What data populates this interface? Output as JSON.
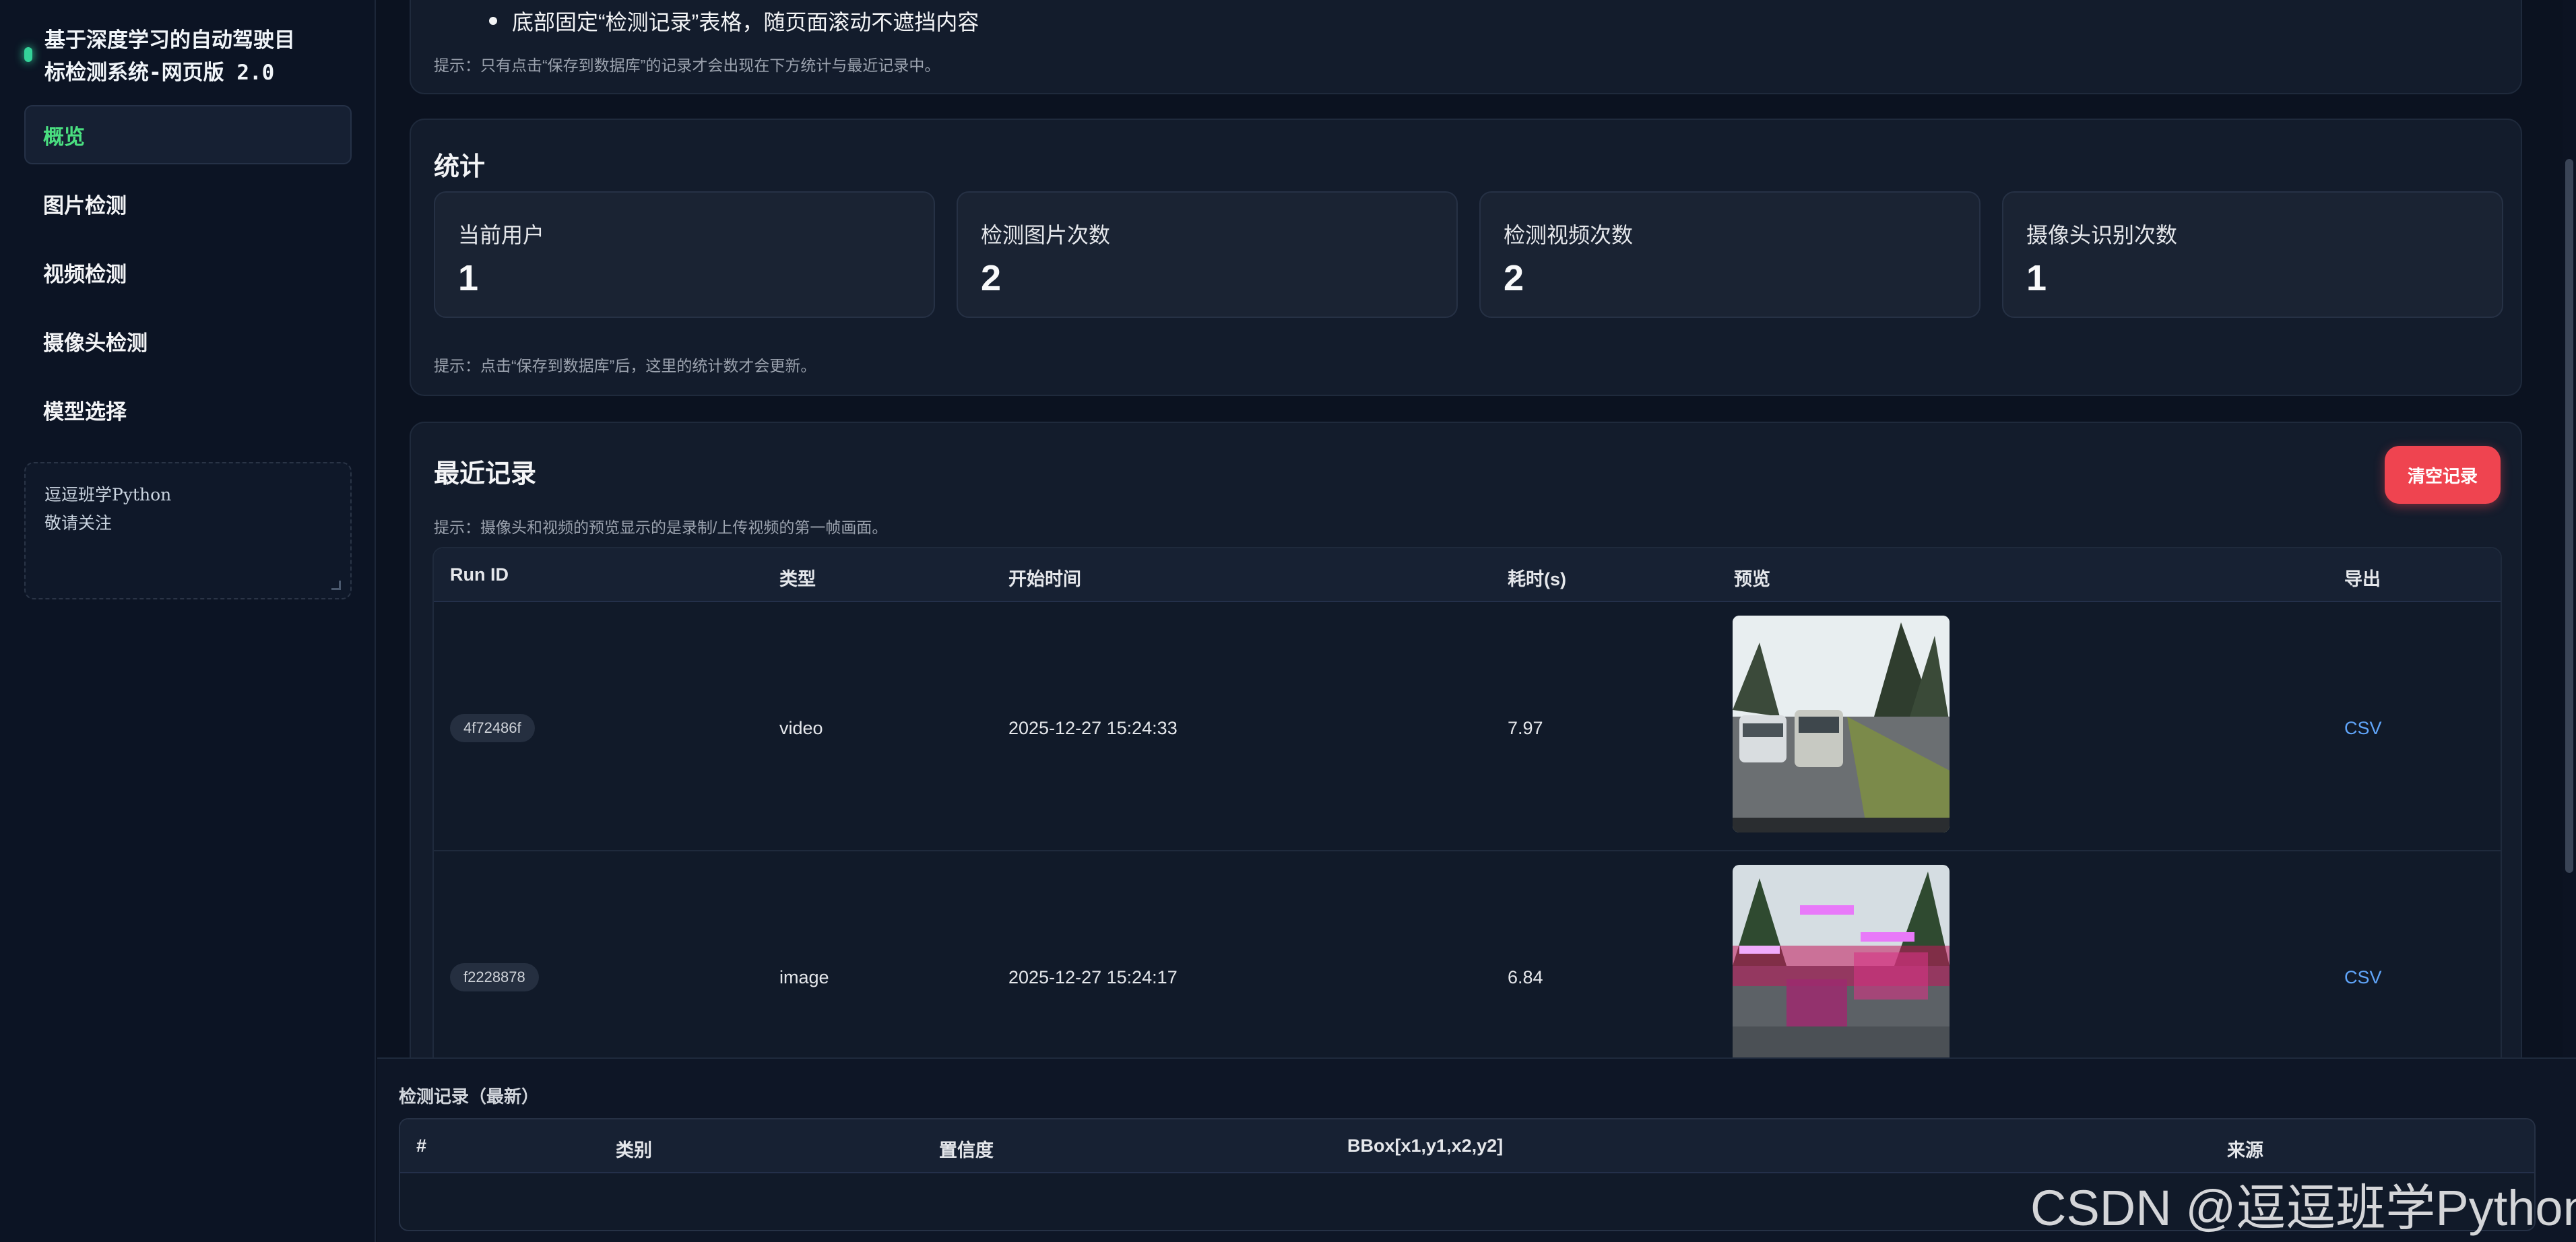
{
  "sidebar": {
    "title_line1": "基于深度学习的自动驾驶目",
    "title_line2": "标检测系统-网页版 2.0",
    "nav": [
      {
        "label": "概览",
        "active": true
      },
      {
        "label": "图片检测"
      },
      {
        "label": "视频检测"
      },
      {
        "label": "摄像头检测"
      },
      {
        "label": "模型选择"
      }
    ],
    "note_line1": "逗逗班学Python",
    "note_line2": "敬请关注"
  },
  "intro": {
    "bullet": "底部固定“检测记录”表格，随页面滚动不遮挡内容",
    "hint": "提示：只有点击“保存到数据库”的记录才会出现在下方统计与最近记录中。"
  },
  "stats": {
    "title": "统计",
    "items": [
      {
        "label": "当前用户",
        "value": "1"
      },
      {
        "label": "检测图片次数",
        "value": "2"
      },
      {
        "label": "检测视频次数",
        "value": "2"
      },
      {
        "label": "摄像头识别次数",
        "value": "1"
      }
    ],
    "hint": "提示：点击“保存到数据库”后，这里的统计数才会更新。"
  },
  "recent": {
    "title": "最近记录",
    "clear_label": "清空记录",
    "hint": "提示：摄像头和视频的预览显示的是录制/上传视频的第一帧画面。",
    "columns": [
      "Run ID",
      "类型",
      "开始时间",
      "耗时(s)",
      "预览",
      "导出"
    ],
    "rows": [
      {
        "run_id": "4f72486f",
        "type": "video",
        "start": "2025-12-27 15:24:33",
        "duration": "7.97",
        "export": "CSV"
      },
      {
        "run_id": "f2228878",
        "type": "image",
        "start": "2025-12-27 15:24:17",
        "duration": "6.84",
        "export": "CSV"
      }
    ]
  },
  "detections": {
    "title": "检测记录（最新）",
    "columns": [
      "#",
      "类别",
      "置信度",
      "BBox[x1,y1,x2,y2]",
      "来源"
    ]
  },
  "watermark": "CSDN @逗逗班学Python",
  "colors": {
    "accent": "#4ade80",
    "danger": "#ef4450",
    "link": "#60a5fa",
    "bg": "#0b1220"
  }
}
